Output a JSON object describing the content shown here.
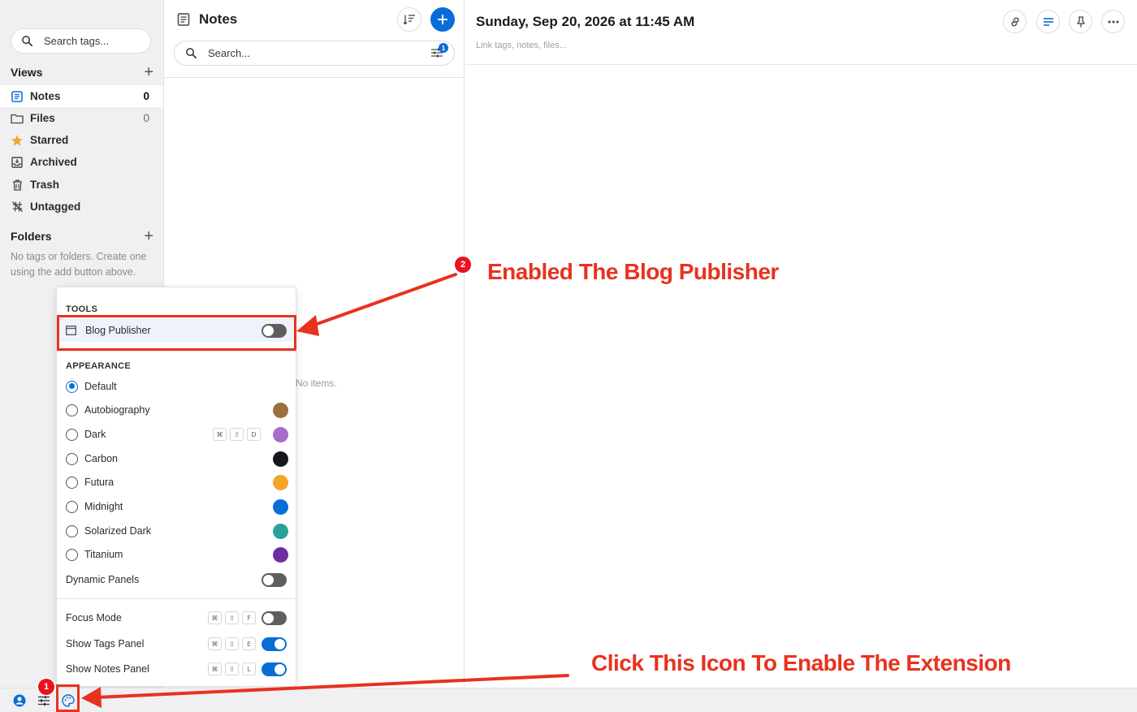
{
  "sidebar": {
    "search_placeholder": "Search tags...",
    "views_label": "Views",
    "items": [
      {
        "label": "Notes",
        "count": "0"
      },
      {
        "label": "Files",
        "count": "0"
      },
      {
        "label": "Starred"
      },
      {
        "label": "Archived"
      },
      {
        "label": "Trash"
      },
      {
        "label": "Untagged"
      }
    ],
    "folders_label": "Folders",
    "folders_empty": "No tags or folders. Create one using the add button above."
  },
  "notes": {
    "title": "Notes",
    "search_placeholder": "Search...",
    "filter_badge": "1",
    "empty_text": "No items."
  },
  "editor": {
    "title": "Sunday, Sep 20, 2026 at 11:45 AM",
    "links_placeholder": "Link tags, notes, files..."
  },
  "menu": {
    "tools_label": "TOOLS",
    "blog_publisher": "Blog Publisher",
    "appearance_label": "APPEARANCE",
    "themes": [
      {
        "label": "Default",
        "selected": true
      },
      {
        "label": "Autobiography",
        "color": "#9c6f3f"
      },
      {
        "label": "Dark",
        "color": "#a76ccc",
        "keys": [
          "⌘",
          "⇧",
          "D"
        ]
      },
      {
        "label": "Carbon",
        "color": "#16161d"
      },
      {
        "label": "Futura",
        "color": "#f5a52a"
      },
      {
        "label": "Midnight",
        "color": "#086dd6"
      },
      {
        "label": "Solarized Dark",
        "color": "#2aa198"
      },
      {
        "label": "Titanium",
        "color": "#6f2ea0"
      }
    ],
    "dynamic_panels": "Dynamic Panels",
    "focus_mode": {
      "label": "Focus Mode",
      "keys": [
        "⌘",
        "⇧",
        "F"
      ]
    },
    "show_tags_panel": {
      "label": "Show Tags Panel",
      "keys": [
        "⌘",
        "⇧",
        "E"
      ]
    },
    "show_notes_panel": {
      "label": "Show Notes Panel",
      "keys": [
        "⌘",
        "⇧",
        "L"
      ]
    }
  },
  "annotations": {
    "step1": "1",
    "step2": "2",
    "text_enabled": "Enabled The Blog Publisher",
    "text_click": "Click This Icon To Enable The Extension"
  },
  "colors": {
    "accent": "#086dd6",
    "annotation_red": "#e8321e"
  }
}
